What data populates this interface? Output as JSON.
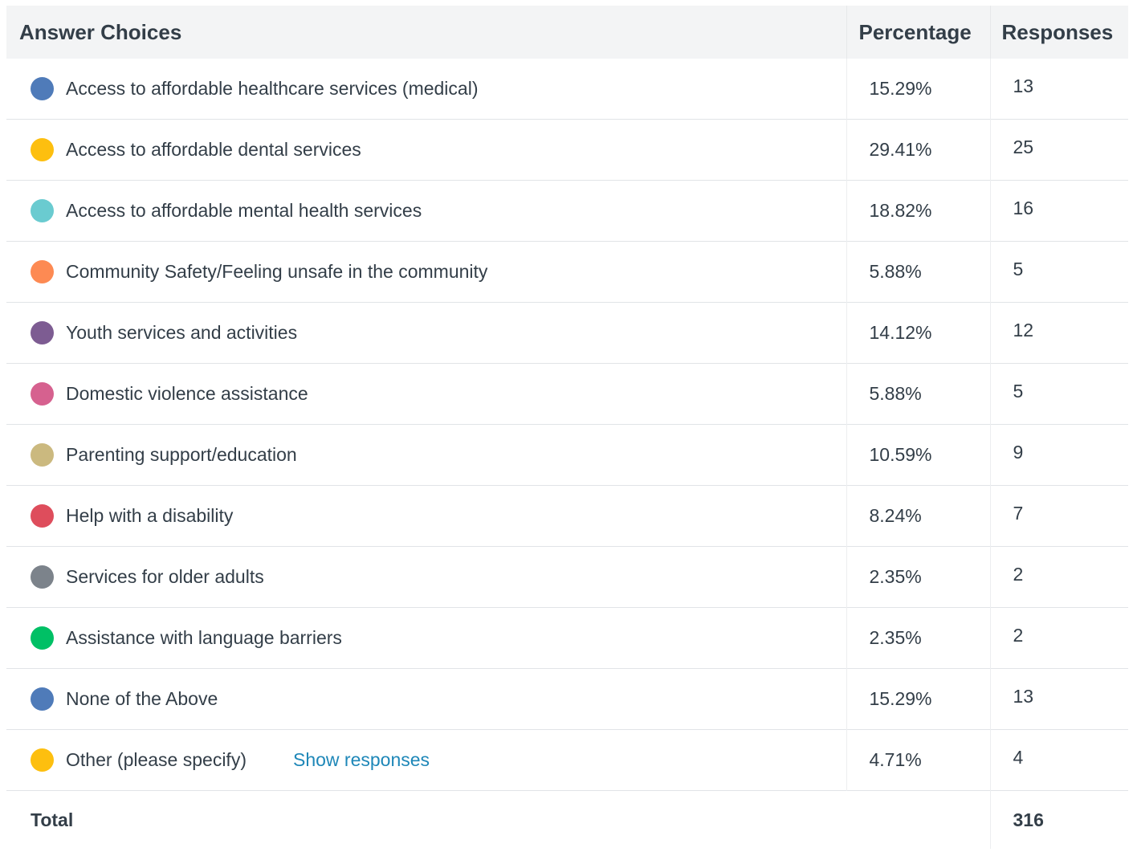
{
  "header": {
    "answer_choices": "Answer Choices",
    "percentage": "Percentage",
    "responses": "Responses"
  },
  "rows": [
    {
      "label": "Access to affordable healthcare services (medical)",
      "percentage": "15.29%",
      "responses": "13",
      "color": "#4f7bb9"
    },
    {
      "label": "Access to affordable dental services",
      "percentage": "29.41%",
      "responses": "25",
      "color": "#fdbf0f"
    },
    {
      "label": "Access to affordable mental health services",
      "percentage": "18.82%",
      "responses": "16",
      "color": "#6acbd0"
    },
    {
      "label": "Community Safety/Feeling unsafe in the community",
      "percentage": "5.88%",
      "responses": "5",
      "color": "#fd8a53"
    },
    {
      "label": "Youth services and activities",
      "percentage": "14.12%",
      "responses": "12",
      "color": "#7d5c92"
    },
    {
      "label": "Domestic violence assistance",
      "percentage": "5.88%",
      "responses": "5",
      "color": "#d6618f"
    },
    {
      "label": "Parenting support/education",
      "percentage": "10.59%",
      "responses": "9",
      "color": "#cbb97f"
    },
    {
      "label": "Help with a disability",
      "percentage": "8.24%",
      "responses": "7",
      "color": "#de4d5c"
    },
    {
      "label": "Services for older adults",
      "percentage": "2.35%",
      "responses": "2",
      "color": "#7c838b"
    },
    {
      "label": "Assistance with language barriers",
      "percentage": "2.35%",
      "responses": "2",
      "color": "#00c065"
    },
    {
      "label": "None of the Above",
      "percentage": "15.29%",
      "responses": "13",
      "color": "#4f7bb9"
    },
    {
      "label": "Other (please specify)",
      "percentage": "4.71%",
      "responses": "4",
      "color": "#fdbf0f",
      "link": "Show responses"
    }
  ],
  "footer": {
    "total_label": "Total",
    "total_value": "316"
  }
}
